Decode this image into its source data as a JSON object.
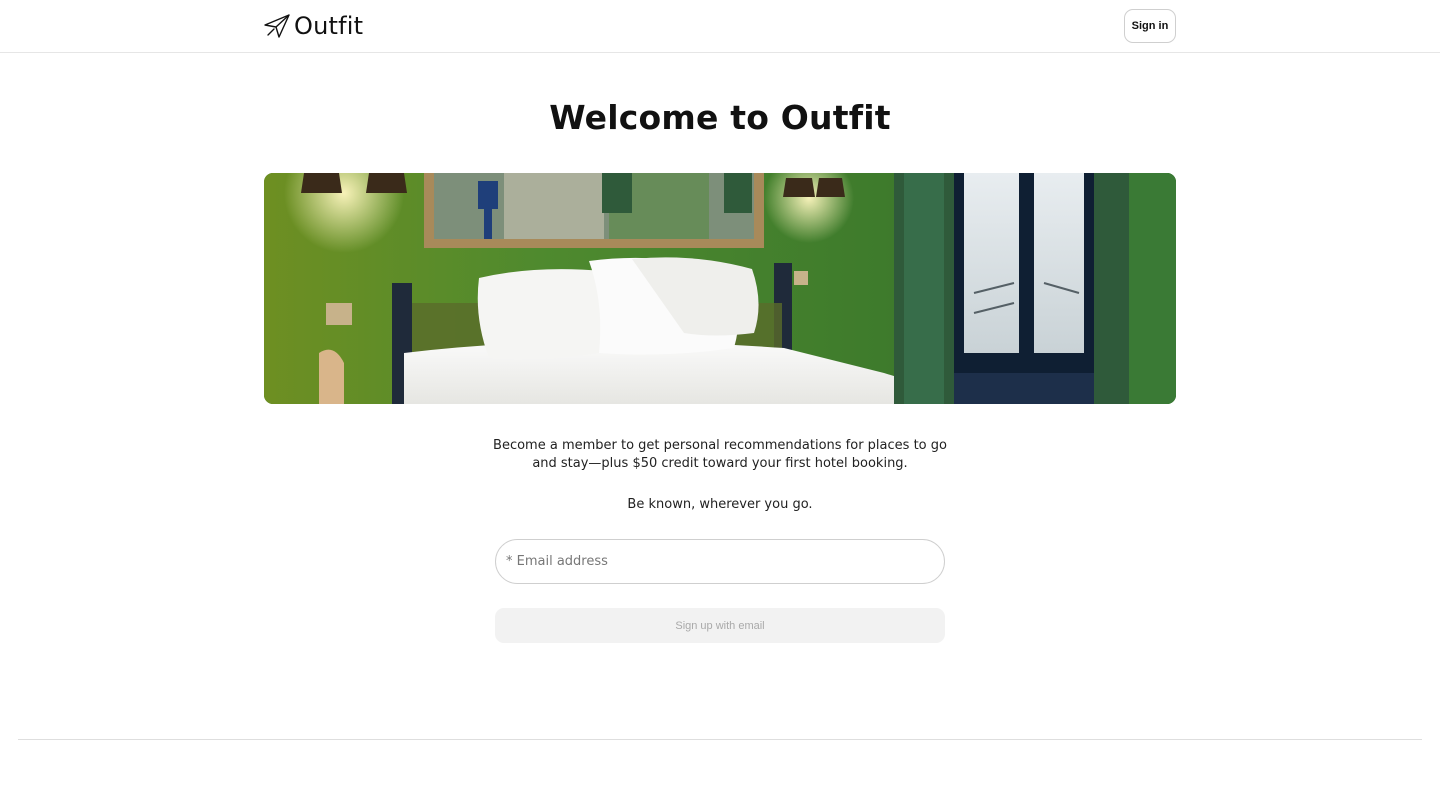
{
  "header": {
    "brand_name": "Outfit",
    "brand_icon": "paper-plane-bird-icon",
    "signin_label": "Sign in"
  },
  "main": {
    "title": "Welcome to Outfit",
    "hero_image": "hotel-bedroom-photo",
    "description": "Become a member to get personal recommendations for places to go and stay—plus $50 credit toward your first hotel booking.",
    "tagline": "Be known, wherever you go.",
    "email_placeholder": "* Email address",
    "signup_label": "Sign up with email"
  },
  "colors": {
    "text": "#111111",
    "border": "#cfcfcf",
    "button_disabled_bg": "#f2f2f2",
    "button_disabled_text": "#a9a9a9",
    "hero_wall": "#3f7a2b"
  }
}
